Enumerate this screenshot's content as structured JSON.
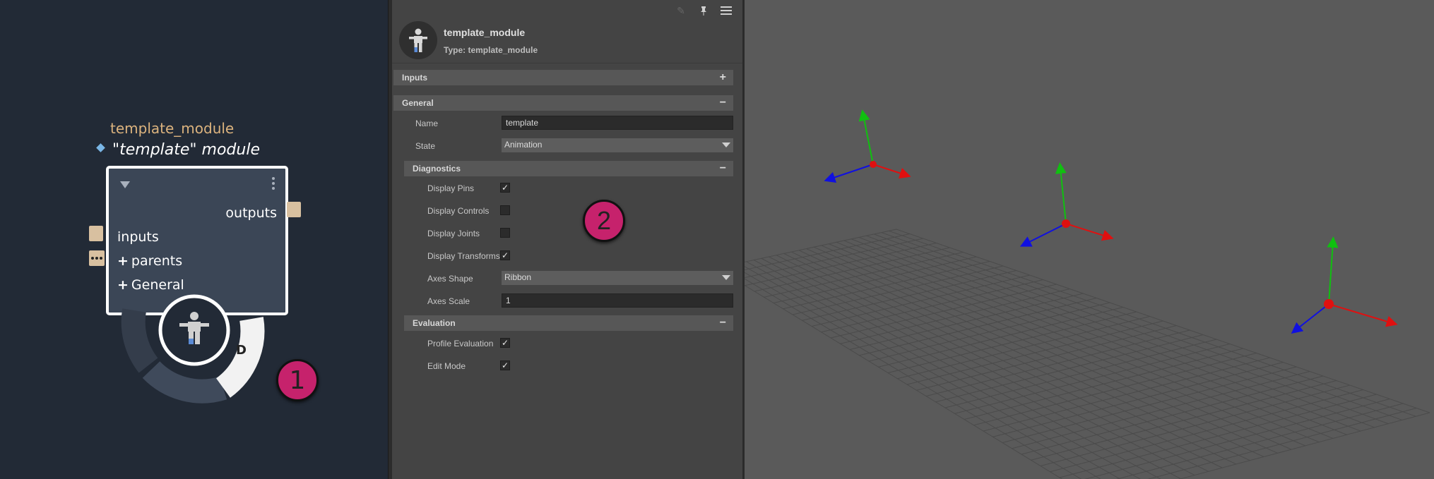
{
  "graph": {
    "node": {
      "type_label": "template_module",
      "instance_label": "\"template\" module",
      "outputs_label": "outputs",
      "inputs_label": "inputs",
      "parents_label": "parents",
      "general_label": "General",
      "expand_symbol": "+",
      "dial_badge": "D"
    },
    "callout_1": "1"
  },
  "attribute_editor": {
    "header": {
      "title": "template_module",
      "type_line": "Type: template_module"
    },
    "sections": {
      "inputs": {
        "label": "Inputs",
        "toggle": "+"
      },
      "general": {
        "label": "General",
        "toggle": "−"
      },
      "diagnostics": {
        "label": "Diagnostics",
        "toggle": "−"
      },
      "evaluation": {
        "label": "Evaluation",
        "toggle": "−"
      }
    },
    "general": {
      "name_label": "Name",
      "name_value": "template",
      "state_label": "State",
      "state_value": "Animation"
    },
    "diagnostics": {
      "display_pins_label": "Display Pins",
      "display_pins_checked": true,
      "display_controls_label": "Display Controls",
      "display_controls_checked": false,
      "display_joints_label": "Display Joints",
      "display_joints_checked": false,
      "display_transforms_label": "Display Transforms",
      "display_transforms_checked": true,
      "axes_shape_label": "Axes Shape",
      "axes_shape_value": "Ribbon",
      "axes_scale_label": "Axes Scale",
      "axes_scale_value": "1"
    },
    "evaluation": {
      "profile_evaluation_label": "Profile Evaluation",
      "profile_evaluation_checked": true,
      "edit_mode_label": "Edit Mode",
      "edit_mode_checked": true
    },
    "callout_2": "2",
    "check_glyph": "✓"
  },
  "colors": {
    "graph_bg": "#222a36",
    "node_body": "#3b4656",
    "node_type_text": "#dcb37e",
    "port": "#d8c0a0",
    "callout": "#c6226c",
    "panel_bg": "#444444",
    "section_bg": "#575757",
    "viewport_bg": "#5a5a5a",
    "axis_x": "#e01010",
    "axis_y": "#10c010",
    "axis_z": "#1010e0"
  },
  "icons": [
    "triangle-down-icon",
    "kebab-menu-icon",
    "character-icon",
    "pencil-icon",
    "pin-icon",
    "hamburger-menu-icon",
    "checkmark-icon",
    "dropdown-arrow-icon",
    "transform-gizmo-icon"
  ]
}
